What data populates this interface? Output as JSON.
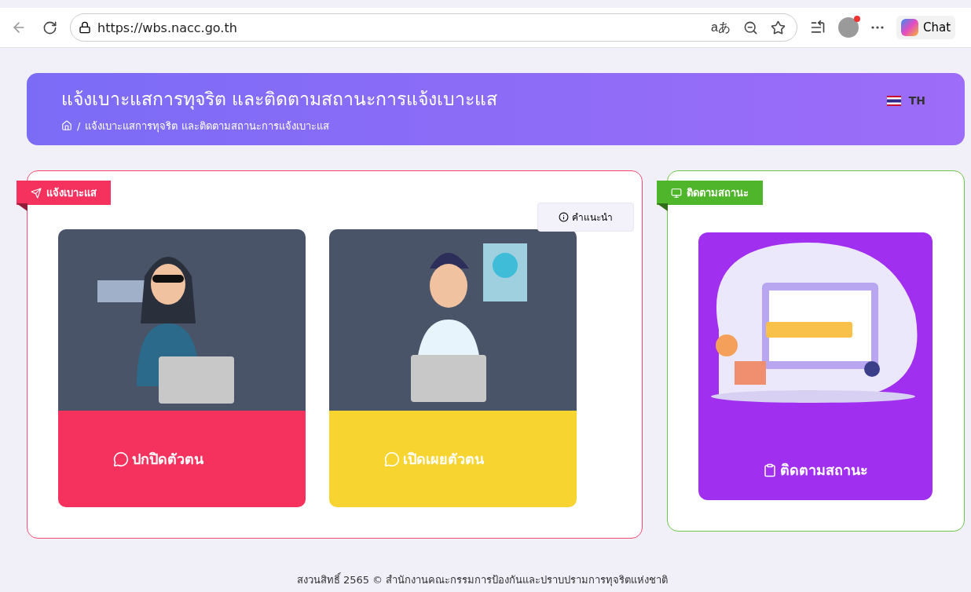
{
  "browser": {
    "url": "https://wbs.nacc.go.th",
    "read_aloud": "aあ",
    "chat_label": "Chat"
  },
  "header": {
    "title": "แจ้งเบาะแสการทุจริต และติดตามสถานะการแจ้งเบาะแส",
    "breadcrumb_separator": "/",
    "breadcrumb": "แจ้งเบาะแสการทุจริต และติดตามสถานะการแจ้งเบาะแส",
    "language": "TH"
  },
  "report_panel": {
    "tag": "แจ้งเบาะแส",
    "guide_button": "คำแนะนำ",
    "options": [
      {
        "kind": "anonymous",
        "label": "ปกปิดตัวตน"
      },
      {
        "kind": "identified",
        "label": "เปิดเผยตัวตน"
      }
    ]
  },
  "track_panel": {
    "tag": "ติดตามสถานะ",
    "option": {
      "label": "ติดตามสถานะ"
    }
  },
  "footer": {
    "text": "สงวนสิทธิ์ 2565 © สำนักงานคณะกรรมการป้องกันและปราบปรามการทุจริตแห่งชาติ"
  }
}
